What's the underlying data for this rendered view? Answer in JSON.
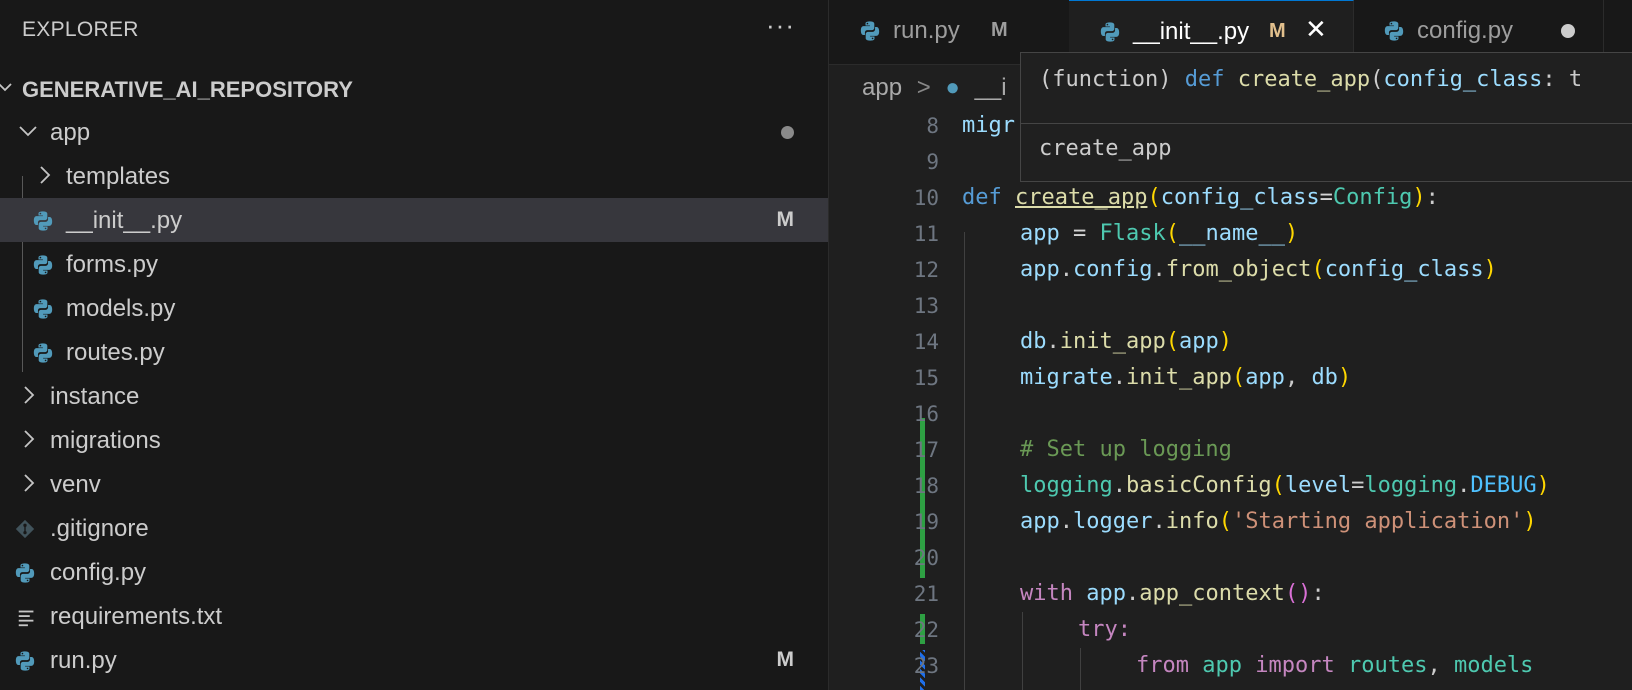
{
  "explorer": {
    "title": "EXPLORER",
    "more_label": "···",
    "root": "GENERATIVE_AI_REPOSITORY",
    "items": [
      {
        "label": "app",
        "badge": ""
      },
      {
        "label": "templates",
        "badge": ""
      },
      {
        "label": "__init__.py",
        "badge": "M"
      },
      {
        "label": "forms.py",
        "badge": ""
      },
      {
        "label": "models.py",
        "badge": ""
      },
      {
        "label": "routes.py",
        "badge": ""
      },
      {
        "label": "instance",
        "badge": ""
      },
      {
        "label": "migrations",
        "badge": ""
      },
      {
        "label": "venv",
        "badge": ""
      },
      {
        "label": ".gitignore",
        "badge": ""
      },
      {
        "label": "config.py",
        "badge": ""
      },
      {
        "label": "requirements.txt",
        "badge": ""
      },
      {
        "label": "run.py",
        "badge": "M"
      }
    ]
  },
  "tabs": [
    {
      "label": "run.py",
      "badge": "M"
    },
    {
      "label": "__init__.py",
      "badge": "M",
      "close": "✕"
    },
    {
      "label": "config.py",
      "badge": ""
    }
  ],
  "breadcrumb": {
    "first": "app",
    "sep": ">",
    "second": "__i"
  },
  "hover": {
    "kind": "(function) ",
    "kw": "def",
    "name": "create_app",
    "param": "config_class",
    "rest": ": t",
    "doc": "create_app"
  },
  "code": {
    "line_numbers": [
      "8",
      "9",
      "10",
      "11",
      "12",
      "13",
      "14",
      "15",
      "16",
      "17",
      "18",
      "19",
      "20",
      "21",
      "22",
      "23"
    ],
    "l8": "migr",
    "l10": {
      "def": "def",
      "name": "create_app",
      "param": "config_class",
      "eq": "=",
      "cls": "Config",
      "end": ":"
    },
    "l11": {
      "app": "app",
      "eq": " = ",
      "flask": "Flask",
      "arg": "__name__"
    },
    "l12": {
      "app": "app",
      "config": "config",
      "fn": "from_object",
      "arg": "config_class"
    },
    "l14": {
      "db": "db",
      "fn": "init_app",
      "arg": "app"
    },
    "l15": {
      "obj": "migrate",
      "fn": "init_app",
      "a1": "app",
      "a2": "db"
    },
    "l17": "# Set up logging",
    "l18": {
      "obj": "logging",
      "fn": "basicConfig",
      "kw": "level",
      "mod": "logging",
      "cst": "DEBUG"
    },
    "l19": {
      "app": "app",
      "logger": "logger",
      "fn": "info",
      "str": "'Starting application'"
    },
    "l21": {
      "with": "with",
      "app": "app",
      "fn": "app_context"
    },
    "l22": "try:",
    "l23": {
      "from": "from",
      "mod": "app",
      "imp": "import",
      "a": "routes",
      "b": "models"
    }
  }
}
